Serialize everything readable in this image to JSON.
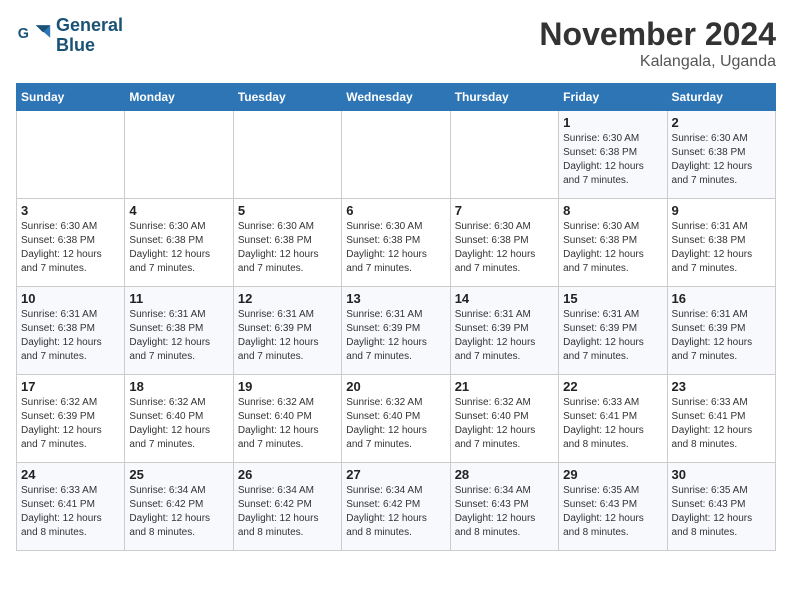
{
  "logo": {
    "line1": "General",
    "line2": "Blue"
  },
  "title": "November 2024",
  "location": "Kalangala, Uganda",
  "days_of_week": [
    "Sunday",
    "Monday",
    "Tuesday",
    "Wednesday",
    "Thursday",
    "Friday",
    "Saturday"
  ],
  "weeks": [
    [
      {
        "day": "",
        "info": ""
      },
      {
        "day": "",
        "info": ""
      },
      {
        "day": "",
        "info": ""
      },
      {
        "day": "",
        "info": ""
      },
      {
        "day": "",
        "info": ""
      },
      {
        "day": "1",
        "info": "Sunrise: 6:30 AM\nSunset: 6:38 PM\nDaylight: 12 hours\nand 7 minutes."
      },
      {
        "day": "2",
        "info": "Sunrise: 6:30 AM\nSunset: 6:38 PM\nDaylight: 12 hours\nand 7 minutes."
      }
    ],
    [
      {
        "day": "3",
        "info": "Sunrise: 6:30 AM\nSunset: 6:38 PM\nDaylight: 12 hours\nand 7 minutes."
      },
      {
        "day": "4",
        "info": "Sunrise: 6:30 AM\nSunset: 6:38 PM\nDaylight: 12 hours\nand 7 minutes."
      },
      {
        "day": "5",
        "info": "Sunrise: 6:30 AM\nSunset: 6:38 PM\nDaylight: 12 hours\nand 7 minutes."
      },
      {
        "day": "6",
        "info": "Sunrise: 6:30 AM\nSunset: 6:38 PM\nDaylight: 12 hours\nand 7 minutes."
      },
      {
        "day": "7",
        "info": "Sunrise: 6:30 AM\nSunset: 6:38 PM\nDaylight: 12 hours\nand 7 minutes."
      },
      {
        "day": "8",
        "info": "Sunrise: 6:30 AM\nSunset: 6:38 PM\nDaylight: 12 hours\nand 7 minutes."
      },
      {
        "day": "9",
        "info": "Sunrise: 6:31 AM\nSunset: 6:38 PM\nDaylight: 12 hours\nand 7 minutes."
      }
    ],
    [
      {
        "day": "10",
        "info": "Sunrise: 6:31 AM\nSunset: 6:38 PM\nDaylight: 12 hours\nand 7 minutes."
      },
      {
        "day": "11",
        "info": "Sunrise: 6:31 AM\nSunset: 6:38 PM\nDaylight: 12 hours\nand 7 minutes."
      },
      {
        "day": "12",
        "info": "Sunrise: 6:31 AM\nSunset: 6:39 PM\nDaylight: 12 hours\nand 7 minutes."
      },
      {
        "day": "13",
        "info": "Sunrise: 6:31 AM\nSunset: 6:39 PM\nDaylight: 12 hours\nand 7 minutes."
      },
      {
        "day": "14",
        "info": "Sunrise: 6:31 AM\nSunset: 6:39 PM\nDaylight: 12 hours\nand 7 minutes."
      },
      {
        "day": "15",
        "info": "Sunrise: 6:31 AM\nSunset: 6:39 PM\nDaylight: 12 hours\nand 7 minutes."
      },
      {
        "day": "16",
        "info": "Sunrise: 6:31 AM\nSunset: 6:39 PM\nDaylight: 12 hours\nand 7 minutes."
      }
    ],
    [
      {
        "day": "17",
        "info": "Sunrise: 6:32 AM\nSunset: 6:39 PM\nDaylight: 12 hours\nand 7 minutes."
      },
      {
        "day": "18",
        "info": "Sunrise: 6:32 AM\nSunset: 6:40 PM\nDaylight: 12 hours\nand 7 minutes."
      },
      {
        "day": "19",
        "info": "Sunrise: 6:32 AM\nSunset: 6:40 PM\nDaylight: 12 hours\nand 7 minutes."
      },
      {
        "day": "20",
        "info": "Sunrise: 6:32 AM\nSunset: 6:40 PM\nDaylight: 12 hours\nand 7 minutes."
      },
      {
        "day": "21",
        "info": "Sunrise: 6:32 AM\nSunset: 6:40 PM\nDaylight: 12 hours\nand 7 minutes."
      },
      {
        "day": "22",
        "info": "Sunrise: 6:33 AM\nSunset: 6:41 PM\nDaylight: 12 hours\nand 8 minutes."
      },
      {
        "day": "23",
        "info": "Sunrise: 6:33 AM\nSunset: 6:41 PM\nDaylight: 12 hours\nand 8 minutes."
      }
    ],
    [
      {
        "day": "24",
        "info": "Sunrise: 6:33 AM\nSunset: 6:41 PM\nDaylight: 12 hours\nand 8 minutes."
      },
      {
        "day": "25",
        "info": "Sunrise: 6:34 AM\nSunset: 6:42 PM\nDaylight: 12 hours\nand 8 minutes."
      },
      {
        "day": "26",
        "info": "Sunrise: 6:34 AM\nSunset: 6:42 PM\nDaylight: 12 hours\nand 8 minutes."
      },
      {
        "day": "27",
        "info": "Sunrise: 6:34 AM\nSunset: 6:42 PM\nDaylight: 12 hours\nand 8 minutes."
      },
      {
        "day": "28",
        "info": "Sunrise: 6:34 AM\nSunset: 6:43 PM\nDaylight: 12 hours\nand 8 minutes."
      },
      {
        "day": "29",
        "info": "Sunrise: 6:35 AM\nSunset: 6:43 PM\nDaylight: 12 hours\nand 8 minutes."
      },
      {
        "day": "30",
        "info": "Sunrise: 6:35 AM\nSunset: 6:43 PM\nDaylight: 12 hours\nand 8 minutes."
      }
    ]
  ]
}
